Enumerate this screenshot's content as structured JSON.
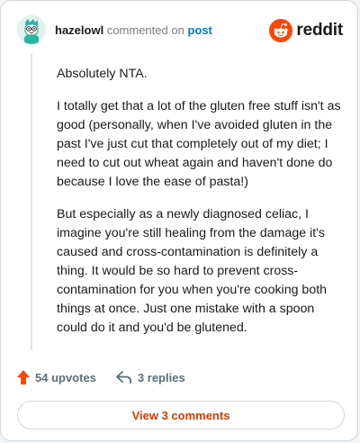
{
  "header": {
    "username": "hazelowl",
    "action_text": "commented on",
    "post_link": "post",
    "brand_name": "reddit"
  },
  "comment": {
    "paragraphs": [
      "Absolutely NTA.",
      "I totally get that a lot of the gluten free stuff isn't as good (personally, when I've avoided gluten in the past I've just cut that completely out of my diet; I need to cut out wheat again and haven't done do because I love the ease of pasta!)",
      "But especially as a newly diagnosed celiac, I imagine you're still healing from the damage it's caused and cross-contamination is definitely a thing. It would be so hard to prevent cross-contamination for you when you're cooking both things at once. Just one mistake with a spoon could do it and you'd be glutened."
    ]
  },
  "actions": {
    "upvotes_label": "54 upvotes",
    "replies_label": "3 replies"
  },
  "footer": {
    "view_comments_label": "View 3 comments"
  },
  "icons": {
    "avatar": "avatar",
    "brand": "reddit-logo-icon",
    "upvote": "upvote-arrow-icon",
    "reply": "reply-arrow-icon"
  },
  "colors": {
    "brand_orange": "#ff4500",
    "link_blue": "#0079d3",
    "action_gray": "#576f76",
    "button_text": "#d93a00"
  }
}
